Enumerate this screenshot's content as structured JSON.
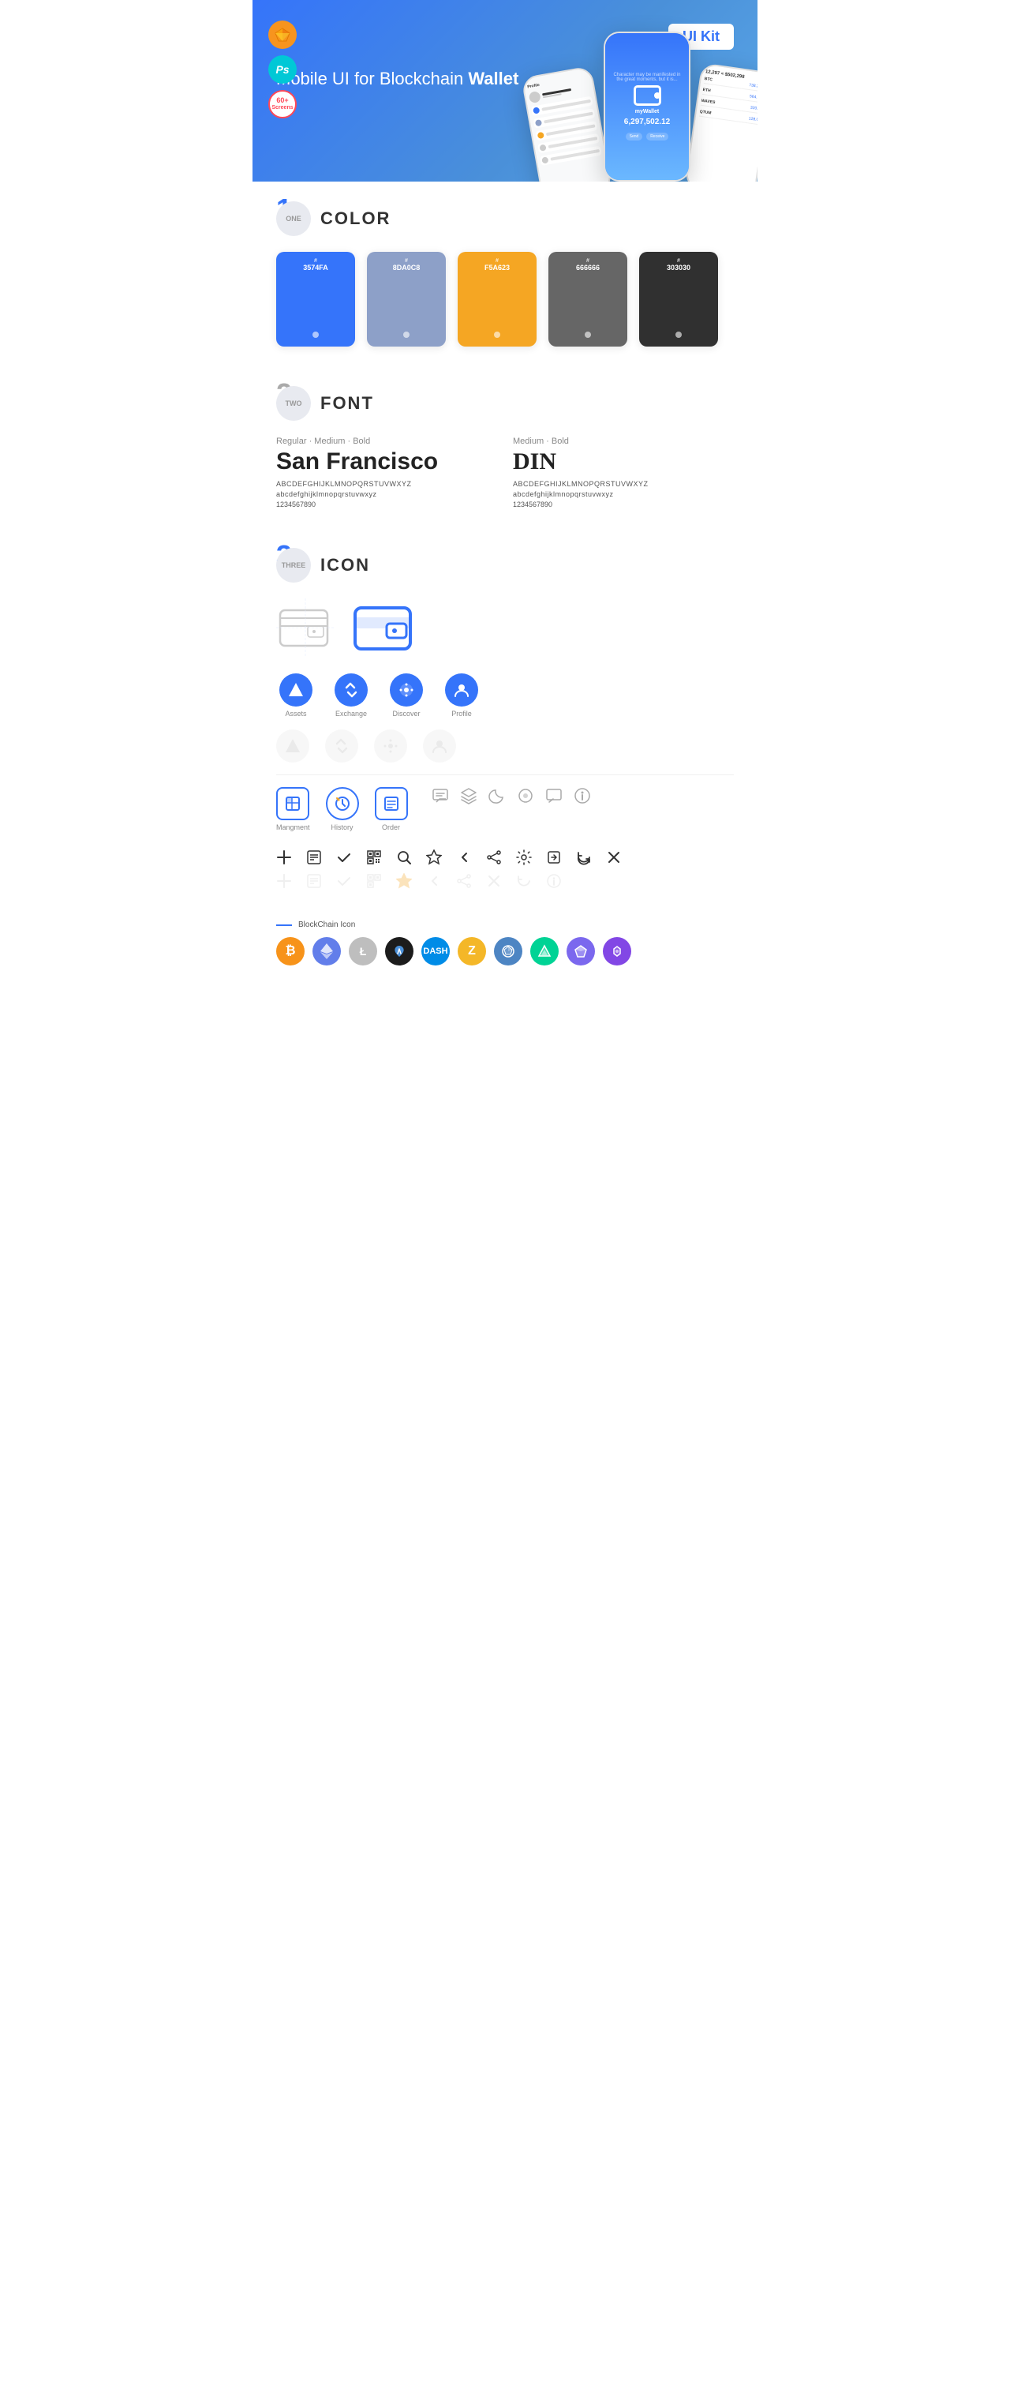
{
  "hero": {
    "title_normal": "Mobile UI for Blockchain ",
    "title_bold": "Wallet",
    "badge": "UI Kit",
    "badges": [
      {
        "type": "sketch",
        "label": "Sk"
      },
      {
        "type": "ps",
        "label": "Ps"
      },
      {
        "type": "screens",
        "line1": "60+",
        "line2": "Screens"
      }
    ]
  },
  "sections": {
    "color": {
      "number": "1",
      "number_label": "ONE",
      "title": "COLOR",
      "swatches": [
        {
          "hex": "#3574FA",
          "label": "3574FA"
        },
        {
          "hex": "#8DA0C8",
          "label": "8DA0C8"
        },
        {
          "hex": "#F5A623",
          "label": "F5A623"
        },
        {
          "hex": "#666666",
          "label": "666666"
        },
        {
          "hex": "#303030",
          "label": "303030"
        }
      ]
    },
    "font": {
      "number": "2",
      "number_label": "TWO",
      "title": "FONT",
      "fonts": [
        {
          "weights": "Regular · Medium · Bold",
          "name": "San Francisco",
          "uppercase": "ABCDEFGHIJKLMNOPQRSTUVWXYZ",
          "lowercase": "abcdefghijklmnopqrstuvwxyz",
          "numbers": "1234567890"
        },
        {
          "weights": "Medium · Bold",
          "name": "DIN",
          "uppercase": "ABCDEFGHIJKLMNOPQRSTUVWXYZ",
          "lowercase": "abcdefghijklmnopqrstuvwxyz",
          "numbers": "1234567890"
        }
      ]
    },
    "icon": {
      "number": "3",
      "number_label": "THREE",
      "title": "ICON",
      "nav_icons": [
        {
          "label": "Assets"
        },
        {
          "label": "Exchange"
        },
        {
          "label": "Discover"
        },
        {
          "label": "Profile"
        }
      ],
      "tab_icons": [
        {
          "label": "Mangment"
        },
        {
          "label": "History"
        },
        {
          "label": "Order"
        }
      ],
      "blockchain_label": "BlockChain Icon",
      "cryptos": [
        {
          "symbol": "₿",
          "color": "#F7931A",
          "name": "Bitcoin"
        },
        {
          "symbol": "Ξ",
          "color": "#627EEA",
          "name": "Ethereum"
        },
        {
          "symbol": "Ł",
          "color": "#A6A9AA",
          "name": "Litecoin"
        },
        {
          "symbol": "◈",
          "color": "#1C1C1C",
          "name": "BlackCoin"
        },
        {
          "symbol": "D",
          "color": "#008CE7",
          "name": "Dash"
        },
        {
          "symbol": "Z",
          "color": "#ECB244",
          "name": "Zcash"
        },
        {
          "symbol": "◎",
          "color": "#4D85C3",
          "name": "Block"
        },
        {
          "symbol": "▲",
          "color": "#00D395",
          "name": "Compound"
        },
        {
          "symbol": "◆",
          "color": "#8B5CF6",
          "name": "Gem"
        },
        {
          "symbol": "∞",
          "color": "#FF4081",
          "name": "Polygon"
        }
      ]
    }
  }
}
